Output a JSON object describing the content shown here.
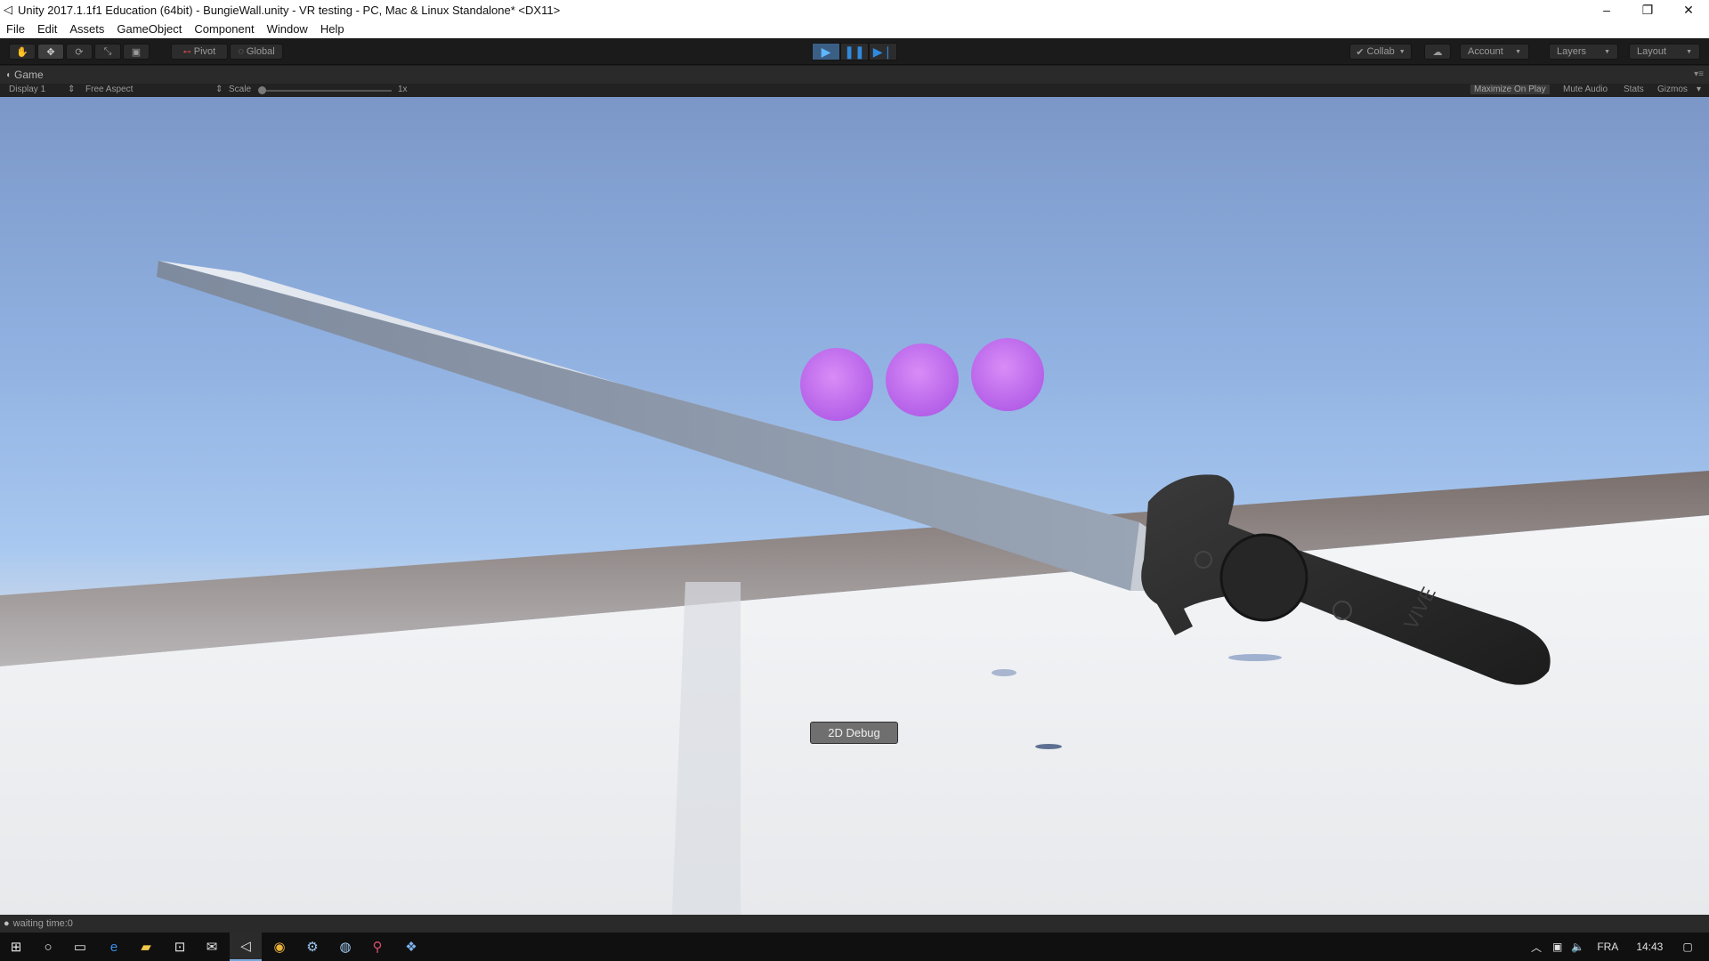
{
  "window": {
    "title": "Unity 2017.1.1f1 Education (64bit) - BungieWall.unity - VR testing - PC, Mac & Linux Standalone* <DX11>",
    "controls": [
      "–",
      "❐",
      "✕"
    ]
  },
  "menu": [
    "File",
    "Edit",
    "Assets",
    "GameObject",
    "Component",
    "Window",
    "Help"
  ],
  "toolbar": {
    "pivot_label": "Pivot",
    "global_label": "Global",
    "collab_label": "Collab",
    "account_label": "Account",
    "layers_label": "Layers",
    "layout_label": "Layout",
    "tool_icons": [
      "hand-tool-icon",
      "move-tool-icon",
      "rotate-tool-icon",
      "scale-tool-icon",
      "rect-tool-icon"
    ],
    "play_state": "playing"
  },
  "game_tab": {
    "label": "Game",
    "display": "Display 1",
    "aspect": "Free Aspect",
    "scale_label": "Scale",
    "scale_value": "1x",
    "maximize_label": "Maximize On Play",
    "mute_label": "Mute Audio",
    "stats_label": "Stats",
    "gizmos_label": "Gizmos"
  },
  "scene": {
    "debug_button": "2D Debug",
    "controller_brand": "VIVE",
    "sphere_color": "#c46df0"
  },
  "status": {
    "message": "waiting time:0"
  },
  "taskbar": {
    "language": "FRA",
    "time": "14:43",
    "app_icons": [
      "start-icon",
      "cortana-icon",
      "task-view-icon",
      "edge-icon",
      "file-explorer-icon",
      "store-icon",
      "mail-icon",
      "unity-icon",
      "chrome-icon",
      "steam-icon",
      "steamvr-icon",
      "maps-icon",
      "app-icon"
    ]
  }
}
